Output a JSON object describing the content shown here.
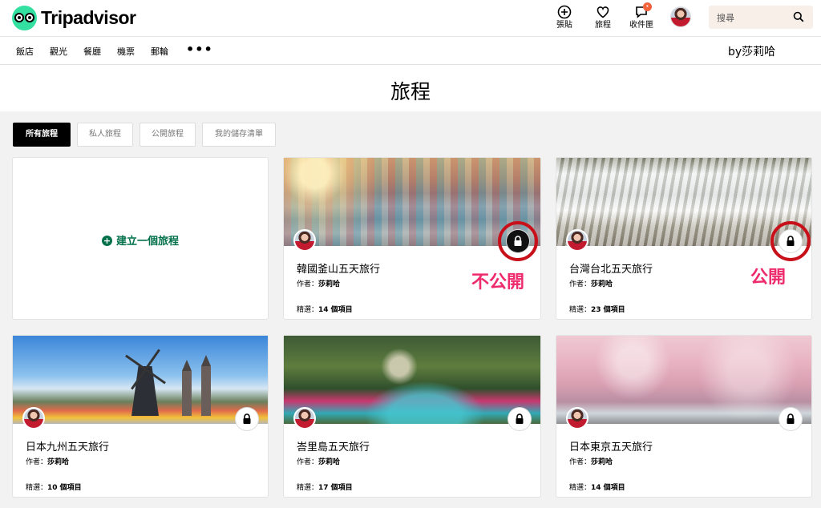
{
  "header": {
    "logo_text": "Tripadvisor",
    "post_label": "張貼",
    "trips_label": "旅程",
    "inbox_label": "收件匣",
    "inbox_badge": "•",
    "search_placeholder": "搜尋"
  },
  "nav": {
    "items": [
      "飯店",
      "觀光",
      "餐廳",
      "機票",
      "郵輪"
    ],
    "more": "•••",
    "byline": "by莎莉哈"
  },
  "page": {
    "title": "旅程"
  },
  "filters": [
    "所有旅程",
    "私人旅程",
    "公開旅程",
    "我的儲存清單"
  ],
  "create_label": "建立一個旅程",
  "author_prefix": "作者：",
  "count_prefix": "精選：",
  "trips": [
    {
      "title": "韓國釜山五天旅行",
      "author": "莎莉哈",
      "count": "14 個項目"
    },
    {
      "title": "台灣台北五天旅行",
      "author": "莎莉哈",
      "count": "23 個項目"
    },
    {
      "title": "日本九州五天旅行",
      "author": "莎莉哈",
      "count": "10 個項目"
    },
    {
      "title": "峇里島五天旅行",
      "author": "莎莉哈",
      "count": "17 個項目"
    },
    {
      "title": "日本東京五天旅行",
      "author": "莎莉哈",
      "count": "14 個項目"
    }
  ],
  "annotations": {
    "private_note": "不公開",
    "public_note": "公開"
  },
  "colors": {
    "brand_green": "#34e0a1",
    "link_green": "#00704a",
    "annotation_red": "#c8101a",
    "annotation_pink": "#ee2b6c"
  }
}
